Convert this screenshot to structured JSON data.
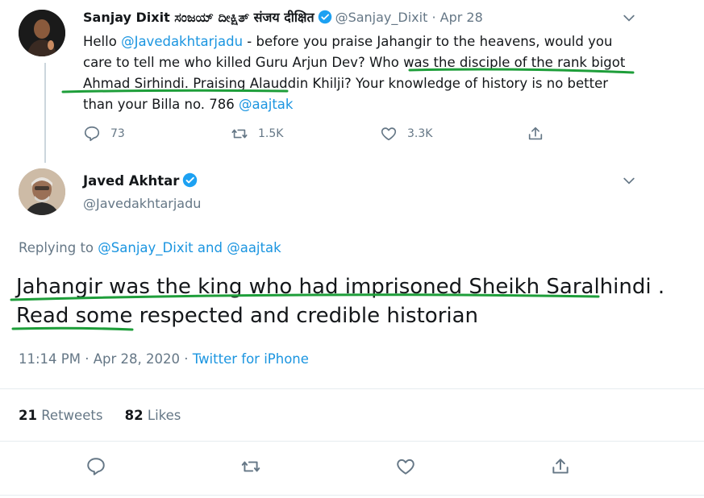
{
  "tweet1": {
    "name": "Sanjay Dixit ಸಂಜಯ್ ದೀಕ್ಷಿತ್ संजय दीक्षित",
    "handle": "@Sanjay_Dixit",
    "date": "Apr 28",
    "text_parts": [
      {
        "t": "Hello ",
        "link": false
      },
      {
        "t": "@Javedakhtarjadu",
        "link": true
      },
      {
        "t": " - before you praise Jahangir to the heavens, would you care to tell me who killed Guru Arjun Dev? Who was the disciple of the rank bigot Ahmad Sirhindi. Praising Alauddin Khilji? Your knowledge of history is no better than your Billa no. 786 ",
        "link": false
      },
      {
        "t": "@aajtak",
        "link": true
      }
    ],
    "replies": "73",
    "retweets": "1.5K",
    "likes": "3.3K"
  },
  "tweet2": {
    "name": "Javed Akhtar",
    "handle": "@Javedakhtarjadu",
    "replying_prefix": "Replying to ",
    "replying_to_1": "@Sanjay_Dixit",
    "replying_and": " and ",
    "replying_to_2": "@aajtak",
    "text": "Jahangir was the king who had imprisoned Sheikh Saralhindi . Read some respected and credible historian",
    "time": "11:14 PM · Apr 28, 2020 · ",
    "source": "Twitter for iPhone",
    "retweet_count": "21",
    "retweet_label": " Retweets",
    "like_count": "82",
    "like_label": " Likes"
  },
  "colors": {
    "link": "#1b95e0",
    "muted": "#657786",
    "verified": "#1da1f2",
    "annotation_underline": "#1e9e3a"
  },
  "icons": [
    "verified-badge-icon",
    "chevron-down-icon",
    "reply-icon",
    "retweet-icon",
    "like-icon",
    "share-icon"
  ]
}
